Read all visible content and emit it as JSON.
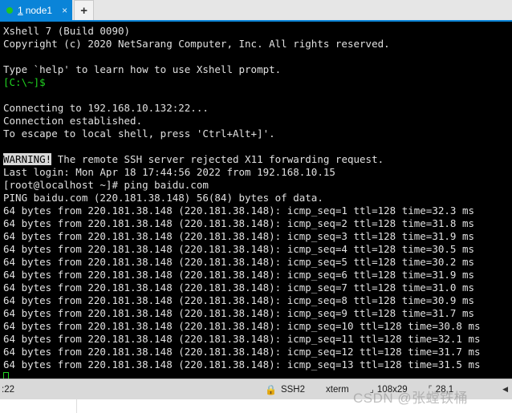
{
  "window": {
    "accent_color": "#0a84d8",
    "terminal_bg": "#000000",
    "terminal_fg": "#e0e0e0",
    "prompt_color": "#21d421"
  },
  "tabbar": {
    "tab": {
      "index": "1",
      "label": "node1",
      "close_label": "×",
      "status_dot": "connected"
    },
    "new_tab_label": "+"
  },
  "terminal": {
    "lines": [
      {
        "text": "Xshell 7 (Build 0090)",
        "style": "normal"
      },
      {
        "text": "Copyright (c) 2020 NetSarang Computer, Inc. All rights reserved.",
        "style": "normal"
      },
      {
        "text": "",
        "style": "blank"
      },
      {
        "text": "Type `help' to learn how to use Xshell prompt.",
        "style": "normal"
      },
      {
        "text": "[C:\\~]$",
        "style": "green"
      },
      {
        "text": "",
        "style": "blank"
      },
      {
        "text": "Connecting to 192.168.10.132:22...",
        "style": "normal"
      },
      {
        "text": "Connection established.",
        "style": "normal"
      },
      {
        "text": "To escape to local shell, press 'Ctrl+Alt+]'.",
        "style": "normal"
      },
      {
        "text": "",
        "style": "blank"
      },
      {
        "text": "WARNING!",
        "rest": " The remote SSH server rejected X11 forwarding request.",
        "style": "inverse-head"
      },
      {
        "text": "Last login: Mon Apr 18 17:44:56 2022 from 192.168.10.15",
        "style": "normal"
      },
      {
        "text": "[root@localhost ~]# ping baidu.com",
        "style": "normal"
      },
      {
        "text": "PING baidu.com (220.181.38.148) 56(84) bytes of data.",
        "style": "normal"
      },
      {
        "text": "64 bytes from 220.181.38.148 (220.181.38.148): icmp_seq=1 ttl=128 time=32.3 ms",
        "style": "normal"
      },
      {
        "text": "64 bytes from 220.181.38.148 (220.181.38.148): icmp_seq=2 ttl=128 time=31.8 ms",
        "style": "normal"
      },
      {
        "text": "64 bytes from 220.181.38.148 (220.181.38.148): icmp_seq=3 ttl=128 time=31.9 ms",
        "style": "normal"
      },
      {
        "text": "64 bytes from 220.181.38.148 (220.181.38.148): icmp_seq=4 ttl=128 time=30.5 ms",
        "style": "normal"
      },
      {
        "text": "64 bytes from 220.181.38.148 (220.181.38.148): icmp_seq=5 ttl=128 time=30.2 ms",
        "style": "normal"
      },
      {
        "text": "64 bytes from 220.181.38.148 (220.181.38.148): icmp_seq=6 ttl=128 time=31.9 ms",
        "style": "normal"
      },
      {
        "text": "64 bytes from 220.181.38.148 (220.181.38.148): icmp_seq=7 ttl=128 time=31.0 ms",
        "style": "normal"
      },
      {
        "text": "64 bytes from 220.181.38.148 (220.181.38.148): icmp_seq=8 ttl=128 time=30.9 ms",
        "style": "normal"
      },
      {
        "text": "64 bytes from 220.181.38.148 (220.181.38.148): icmp_seq=9 ttl=128 time=31.7 ms",
        "style": "normal"
      },
      {
        "text": "64 bytes from 220.181.38.148 (220.181.38.148): icmp_seq=10 ttl=128 time=30.8 ms",
        "style": "normal"
      },
      {
        "text": "64 bytes from 220.181.38.148 (220.181.38.148): icmp_seq=11 ttl=128 time=32.1 ms",
        "style": "normal"
      },
      {
        "text": "64 bytes from 220.181.38.148 (220.181.38.148): icmp_seq=12 ttl=128 time=31.7 ms",
        "style": "normal"
      },
      {
        "text": "64 bytes from 220.181.38.148 (220.181.38.148): icmp_seq=13 ttl=128 time=31.5 ms",
        "style": "normal"
      }
    ]
  },
  "statusbar": {
    "connection": ":22",
    "protocol": "SSH2",
    "terminal_type": "xterm",
    "size": "108x29",
    "position": "28,1",
    "overflow_arrow": "◀"
  },
  "watermark": {
    "text": "CSDN @张螳铁桶"
  }
}
